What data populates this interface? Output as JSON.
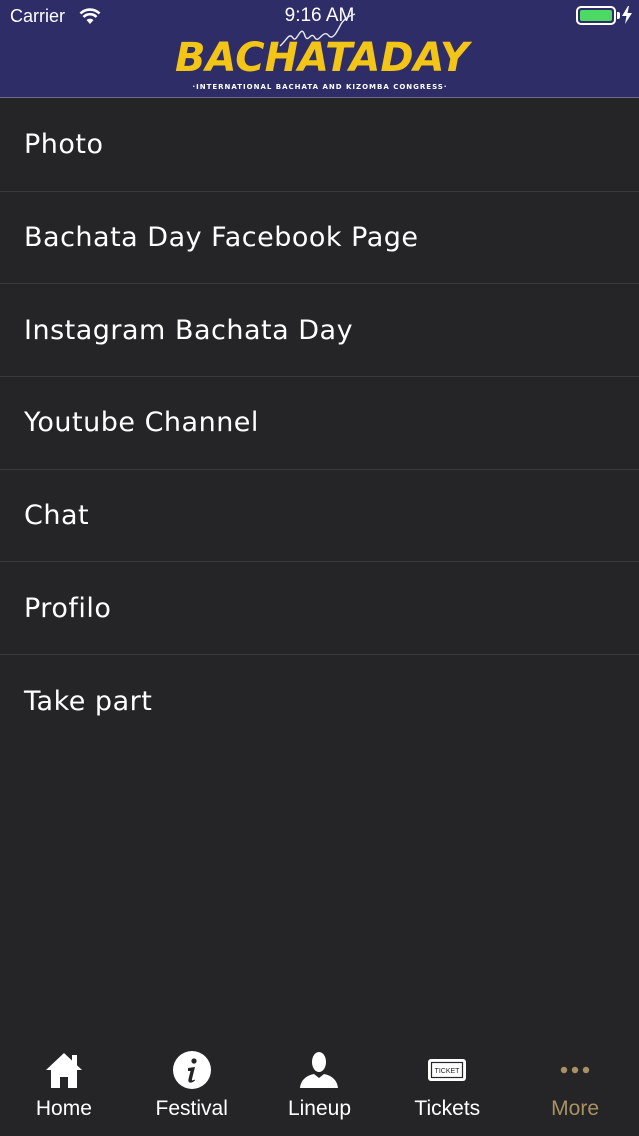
{
  "status_bar": {
    "carrier": "Carrier",
    "time": "9:16 AM"
  },
  "header": {
    "logo_text": "BACHATADAY",
    "logo_subtitle": "·INTERNATIONAL BACHATA AND KIZOMBA CONGRESS·"
  },
  "menu": {
    "items": [
      {
        "label": "Photo"
      },
      {
        "label": "Bachata Day Facebook Page"
      },
      {
        "label": "Instagram Bachata Day"
      },
      {
        "label": "Youtube Channel"
      },
      {
        "label": "Chat"
      },
      {
        "label": "Profilo"
      },
      {
        "label": "Take part"
      }
    ]
  },
  "tabbar": {
    "tabs": [
      {
        "label": "Home",
        "icon": "home-icon"
      },
      {
        "label": "Festival",
        "icon": "info-icon"
      },
      {
        "label": "Lineup",
        "icon": "person-icon"
      },
      {
        "label": "Tickets",
        "icon": "ticket-icon",
        "icon_text": "TICKET"
      },
      {
        "label": "More",
        "icon": "more-icon",
        "active": true
      }
    ]
  },
  "colors": {
    "header_bg": "#2f2d68",
    "logo_yellow": "#f2c516",
    "background": "#252527",
    "tab_active": "#a89163",
    "battery": "#4cd964"
  }
}
